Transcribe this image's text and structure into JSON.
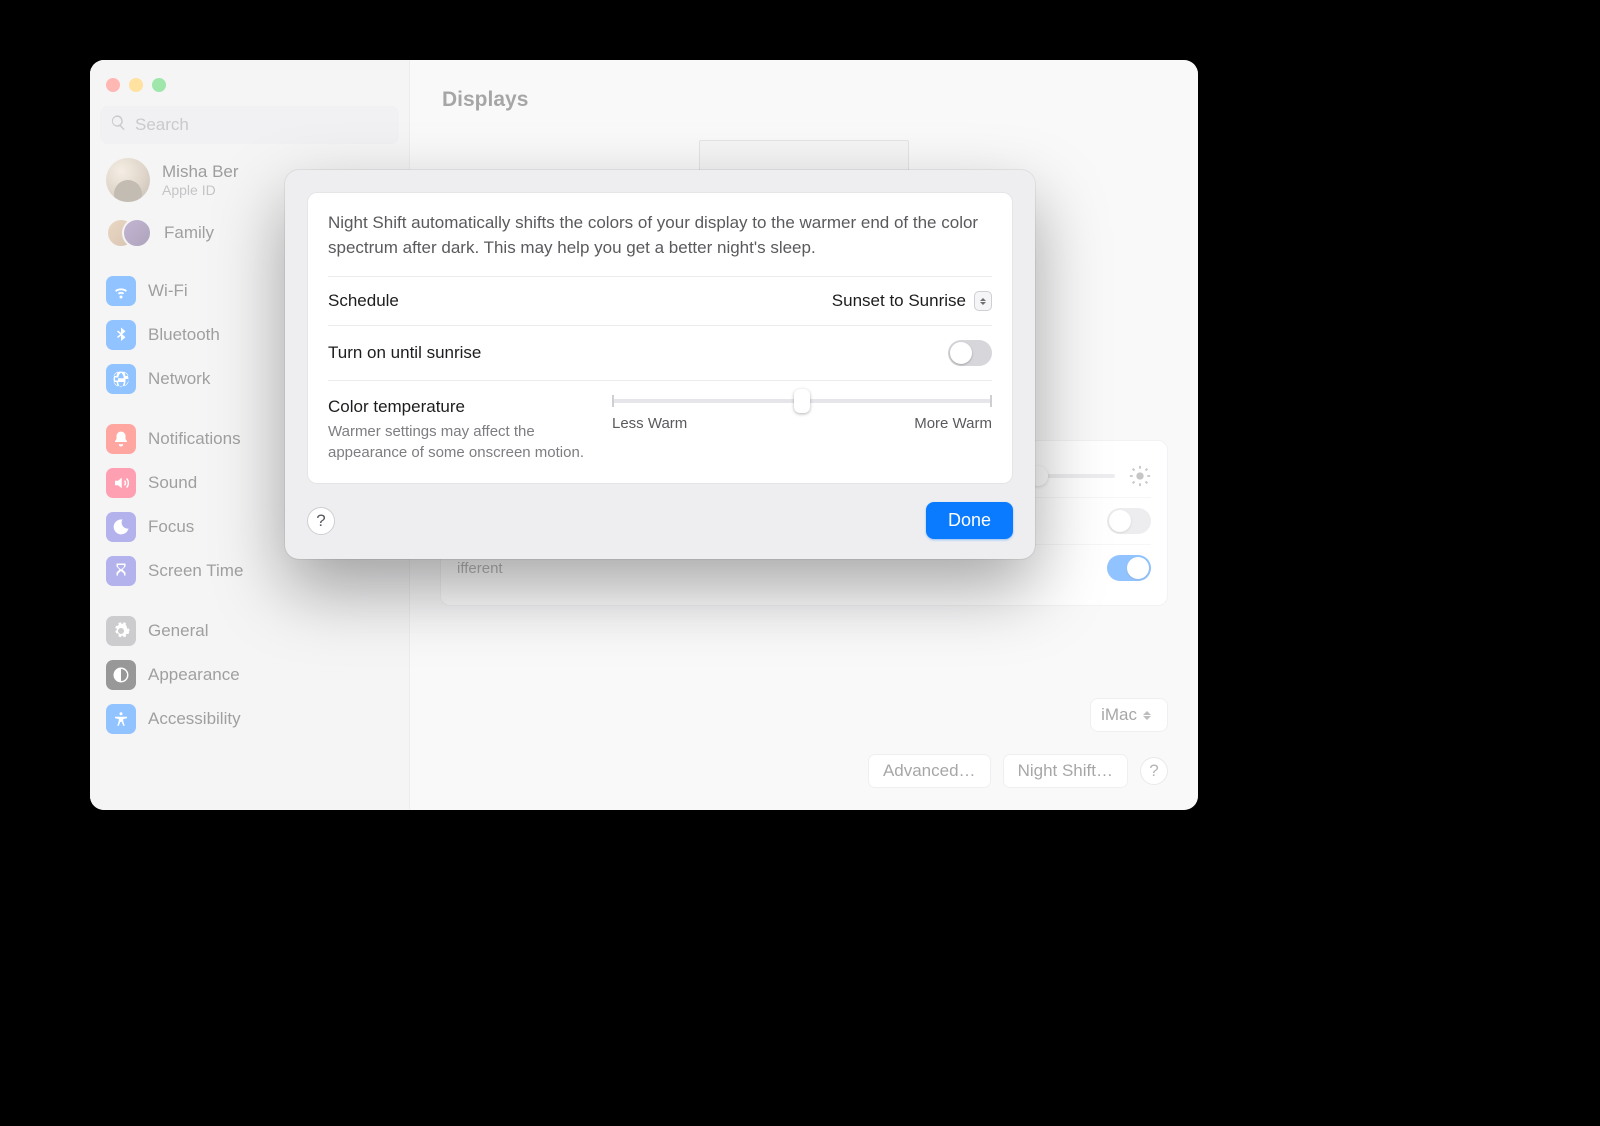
{
  "window": {
    "title": "Displays",
    "search_placeholder": "Search"
  },
  "account": {
    "name": "Misha Ber",
    "subtitle": "Apple ID"
  },
  "family_label": "Family",
  "sidebar": {
    "items": [
      {
        "label": "Wi-Fi"
      },
      {
        "label": "Bluetooth"
      },
      {
        "label": "Network"
      },
      {
        "label": "Notifications"
      },
      {
        "label": "Sound"
      },
      {
        "label": "Focus"
      },
      {
        "label": "Screen Time"
      },
      {
        "label": "General"
      },
      {
        "label": "Appearance"
      },
      {
        "label": "Accessibility"
      }
    ]
  },
  "displays": {
    "profile_selector": "iMac",
    "advanced_button": "Advanced…",
    "night_shift_button": "Night Shift…",
    "truetone_note_fragment": "ifferent"
  },
  "sheet": {
    "description": "Night Shift automatically shifts the colors of your display to the warmer end of the color spectrum after dark. This may help you get a better night's sleep.",
    "schedule_label": "Schedule",
    "schedule_value": "Sunset to Sunrise",
    "turn_on_label": "Turn on until sunrise",
    "turn_on_state": false,
    "color_temp_label": "Color temperature",
    "color_temp_note": "Warmer settings may affect the appearance of some onscreen motion.",
    "slider_min_label": "Less Warm",
    "slider_max_label": "More Warm",
    "done_button": "Done"
  }
}
